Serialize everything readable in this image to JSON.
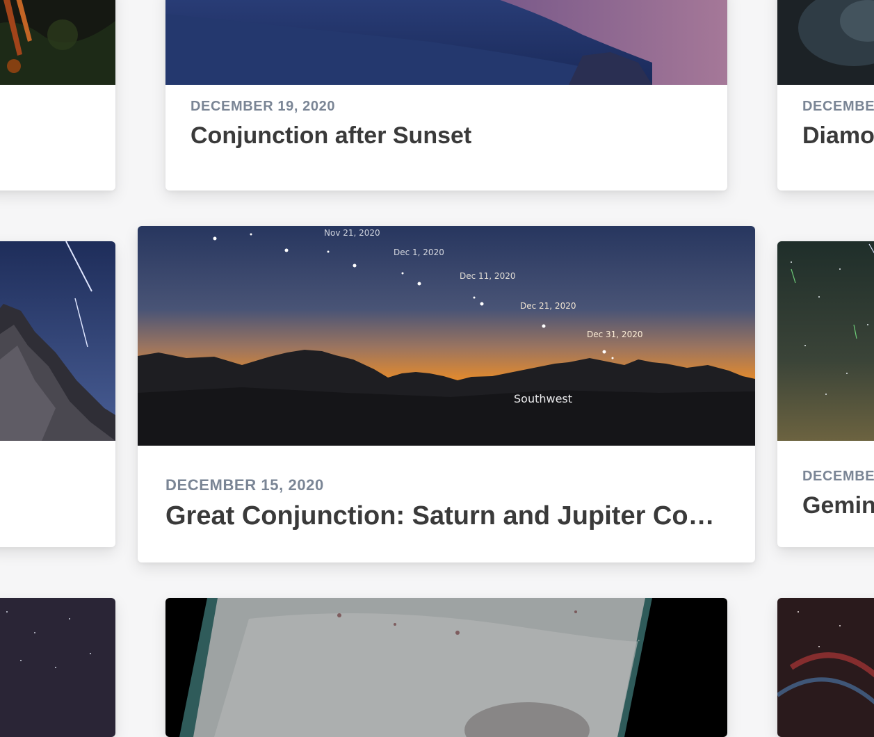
{
  "cards": [
    {
      "id": "top-left"
    },
    {
      "id": "top-center",
      "date": "DECEMBER 19, 2020",
      "title": "Conjunction after Sunset"
    },
    {
      "id": "top-right",
      "date": "DECEMBER",
      "title": "Diamo"
    },
    {
      "id": "mid-left"
    },
    {
      "id": "mid-center",
      "date": "DECEMBER 15, 2020",
      "title": "Great Conjunction: Saturn and Jupiter Con…",
      "image_labels": {
        "dates": [
          "Nov 21, 2020",
          "Dec 1, 2020",
          "Dec 11, 2020",
          "Dec 21, 2020",
          "Dec 31, 2020"
        ],
        "direction": "Southwest"
      }
    },
    {
      "id": "mid-right",
      "date": "DECEMBER",
      "title": "Gemin"
    },
    {
      "id": "bottom-left"
    },
    {
      "id": "bottom-center"
    },
    {
      "id": "bottom-right"
    }
  ]
}
